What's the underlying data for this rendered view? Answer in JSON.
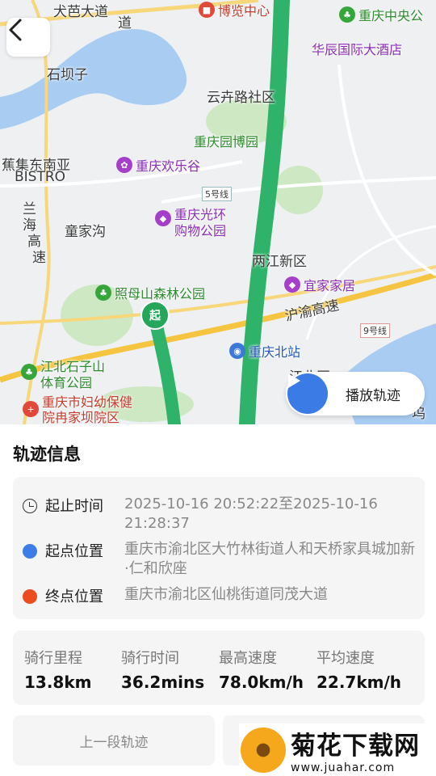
{
  "map": {
    "labels": {
      "road1": "犬芭大道",
      "shibazi": "石坝子",
      "yunhuan": "云卉路社区",
      "bistro1": "蕉集东南亚",
      "bistro2": "BISTRO",
      "zhangjiagou": "童家沟",
      "lianghe": "两江新区",
      "yuhu": "沪渝高速",
      "jiangbei": "江北区",
      "line5": "5号线",
      "line9": "9号线",
      "expressway1": "兰",
      "expressway2": "海",
      "expressway3": "高",
      "expressway4": "速",
      "wudu": "坞",
      "dao": "道"
    },
    "pois": {
      "museum": "博览中心",
      "museum_top": "国际",
      "central": "重庆中央公",
      "huachen": "华辰国际大酒店",
      "expo_garden": "重庆园博园",
      "happy_valley": "重庆欢乐谷",
      "guanghuan1": "重庆光环",
      "guanghuan2": "购物公园",
      "zhaomushan": "照母山森林公园",
      "yijia": "宜家家居",
      "north_station": "重庆北站",
      "shizishan1": "江北石子山",
      "shizishan2": "体育公园",
      "hospital1": "重庆市妇幼保健",
      "hospital2": "院冉家坝院区"
    },
    "start_marker": "起",
    "play_label": "播放轨迹"
  },
  "track_info": {
    "title": "轨迹信息",
    "rows": [
      {
        "key": "起止时间",
        "value": "2025-10-16 20:52:22至2025-10-16 21:28:37",
        "icon": "clock-icon",
        "color": "#333333"
      },
      {
        "key": "起点位置",
        "value": "重庆市渝北区大竹林街道人和天桥家具城加新·仁和欣座",
        "icon": "start-dot-icon",
        "color": "#3d7de6"
      },
      {
        "key": "终点位置",
        "value": "重庆市渝北区仙桃街道同茂大道",
        "icon": "end-dot-icon",
        "color": "#ec4d1f"
      }
    ]
  },
  "stats": [
    {
      "key": "骑行里程",
      "value": "13.8km"
    },
    {
      "key": "骑行时间",
      "value": "36.2mins"
    },
    {
      "key": "最高速度",
      "value": "78.0km/h"
    },
    {
      "key": "平均速度",
      "value": "22.7km/h"
    }
  ],
  "buttons": {
    "prev": "上一段轨迹"
  },
  "watermark": {
    "title": "菊花下载网",
    "url": "www.juahar.com"
  },
  "colors": {
    "track": "#2fb26a",
    "play": "#3a7be5",
    "start_dot": "#3d7de6",
    "end_dot": "#ec4d1f"
  }
}
